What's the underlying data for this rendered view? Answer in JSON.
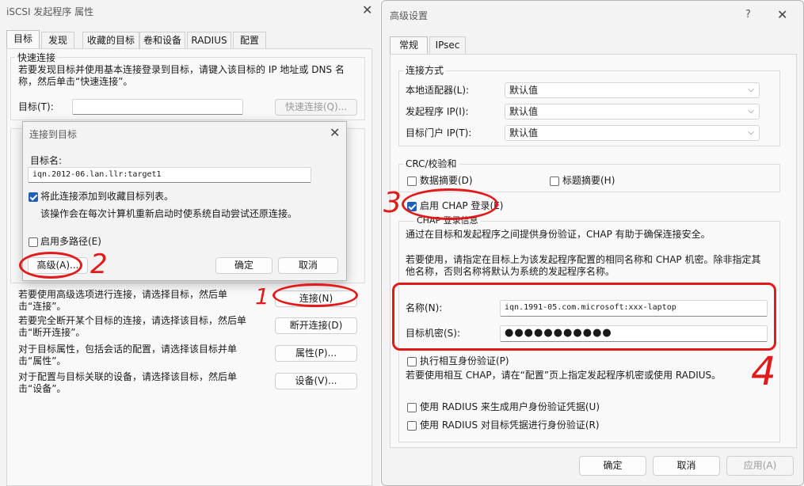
{
  "left_window": {
    "title": "iSCSI 发起程序 属性",
    "tabs": [
      "目标",
      "发现",
      "收藏的目标",
      "卷和设备",
      "RADIUS",
      "配置"
    ],
    "quick_connect": {
      "group_label": "快速连接",
      "description": "若要发现目标并使用基本连接登录到目标，请键入该目标的 IP 地址或 DNS 名称，然后单击“快速连接”。",
      "target_label": "目标(T):",
      "target_value": "",
      "button": "快速连接(Q)..."
    },
    "actions": [
      {
        "text": "若要使用高级选项进行连接，请选择目标，然后单击“连接”。",
        "button": "连接(N)"
      },
      {
        "text": "若要完全断开某个目标的连接，请选择该目标，然后单击“断开连接”。",
        "button": "断开连接(D)"
      },
      {
        "text": "对于目标属性，包括会话的配置，请选择该目标并单击“属性”。",
        "button": "属性(P)..."
      },
      {
        "text": "对于配置与目标关联的设备，请选择该目标，然后单击“设备”。",
        "button": "设备(V)..."
      }
    ]
  },
  "connect_dialog": {
    "title": "连接到目标",
    "target_name_label": "目标名:",
    "target_name_value": "iqn.2012-06.lan.llr:target1",
    "add_favorites": {
      "label": "将此连接添加到收藏目标列表。",
      "checked": true
    },
    "add_favorites_note": "该操作会在每次计算机重新启动时使系统自动尝试还原连接。",
    "multipath": {
      "label": "启用多路径(E)",
      "checked": false
    },
    "advanced_button": "高级(A)...",
    "ok_button": "确定",
    "cancel_button": "取消"
  },
  "advanced_window": {
    "title": "高级设置",
    "help_glyph": "?",
    "tabs": [
      "常规",
      "IPsec"
    ],
    "connection_group": {
      "label": "连接方式",
      "rows": [
        {
          "label": "本地适配器(L):",
          "value": "默认值"
        },
        {
          "label": "发起程序 IP(I):",
          "value": "默认值"
        },
        {
          "label": "目标门户 IP(T):",
          "value": "默认值"
        }
      ]
    },
    "crc_group": {
      "label": "CRC/校验和",
      "data_digest": {
        "label": "数据摘要(D)",
        "checked": false
      },
      "header_digest": {
        "label": "标题摘要(H)",
        "checked": false
      }
    },
    "chap": {
      "enable": {
        "label": "启用 CHAP 登录(E)",
        "checked": true
      },
      "group_label": "CHAP 登录信息",
      "description1": "通过在目标和发起程序之间提供身份验证，CHAP 有助于确保连接安全。",
      "description2": "若要使用，请指定在目标上为该发起程序配置的相同名称和 CHAP 机密。除非指定其他名称，否则名称将默认为系统的发起程序名称。",
      "name_label": "名称(N):",
      "name_value": "iqn.1991-05.com.microsoft:xxx-laptop",
      "secret_label": "目标机密(S):",
      "secret_value": "●●●●●●●●●●●",
      "mutual": {
        "label": "执行相互身份验证(P)",
        "checked": false
      },
      "mutual_note": "若要使用相互 CHAP，请在“配置”页上指定发起程序机密或使用 RADIUS。",
      "radius1": {
        "label": "使用 RADIUS 来生成用户身份验证凭据(U)",
        "checked": false
      },
      "radius2": {
        "label": "使用 RADIUS 对目标凭据进行身份验证(R)",
        "checked": false
      }
    },
    "ok_button": "确定",
    "cancel_button": "取消",
    "apply_button": "应用(A)"
  },
  "annotations": {
    "one": "1",
    "two": "2",
    "three": "3",
    "four": "4"
  },
  "colors": {
    "annotation_red": "#e11b1b",
    "checkbox_blue": "#1f5fb8"
  }
}
